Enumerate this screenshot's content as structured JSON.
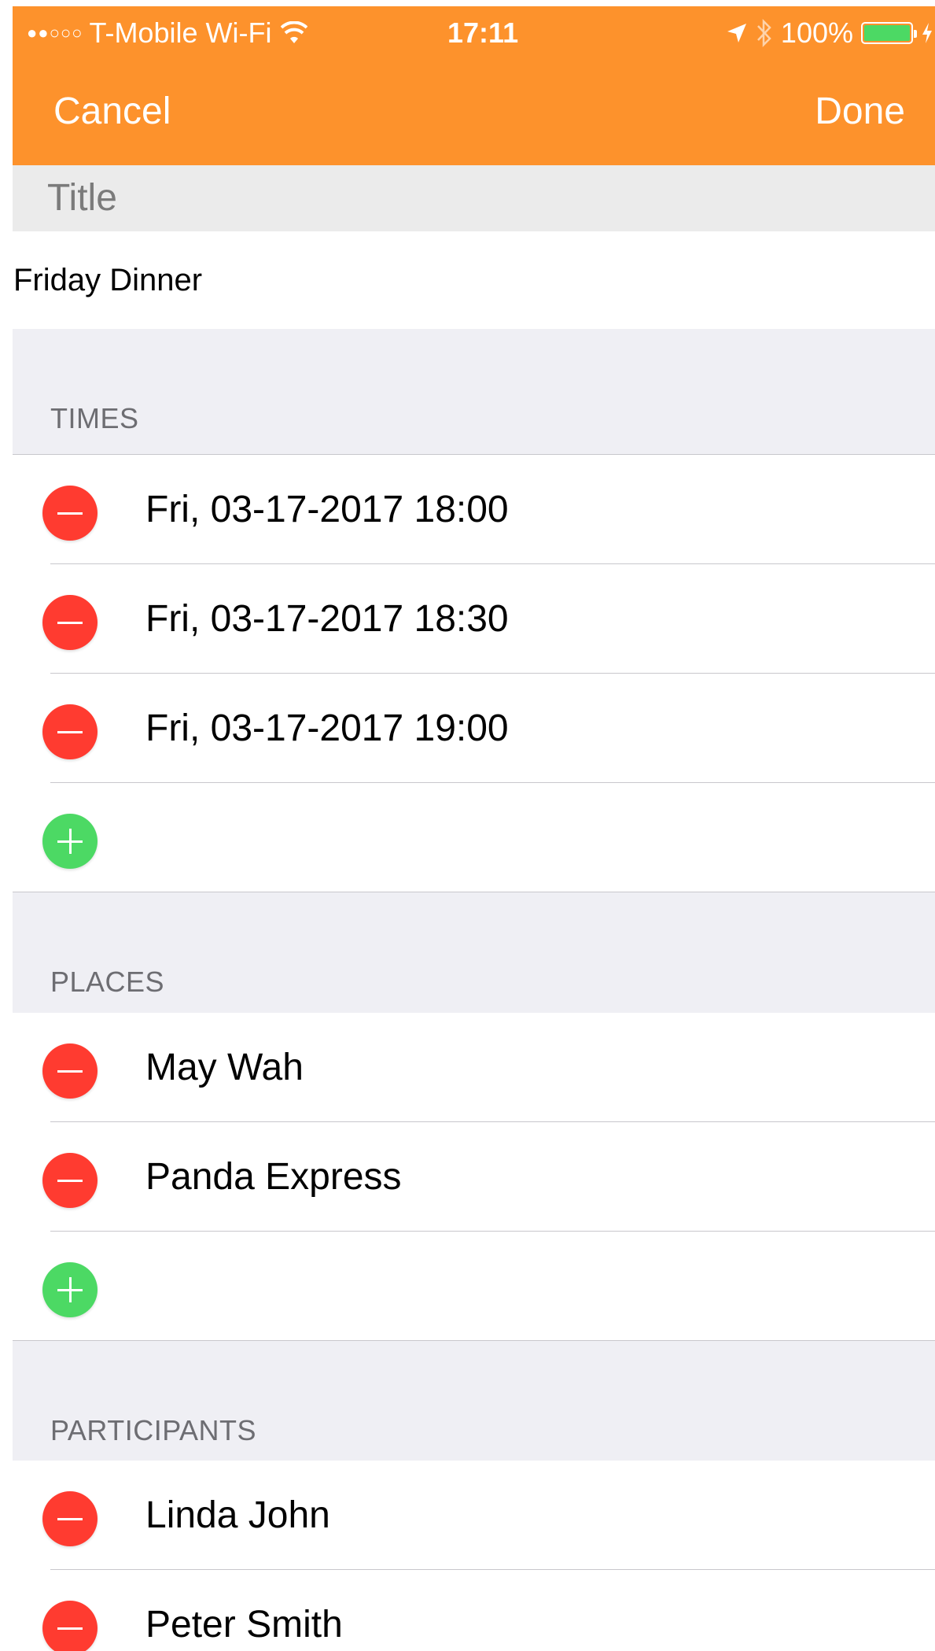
{
  "status_bar": {
    "signal": "●●○○○",
    "carrier": "T-Mobile Wi-Fi",
    "time": "17:11",
    "battery_percent": "100%",
    "battery_level": 1.0,
    "icons": [
      "wifi-icon",
      "location-arrow-icon",
      "bluetooth-icon",
      "battery-icon",
      "charging-bolt-icon"
    ]
  },
  "nav": {
    "cancel": "Cancel",
    "done": "Done"
  },
  "title": {
    "label": "Title",
    "value": "Friday Dinner"
  },
  "sections": {
    "times": {
      "header": "TIMES",
      "items": [
        "Fri, 03-17-2017 18:00",
        "Fri, 03-17-2017 18:30",
        "Fri, 03-17-2017 19:00"
      ]
    },
    "places": {
      "header": "PLACES",
      "items": [
        "May Wah",
        "Panda Express"
      ]
    },
    "participants": {
      "header": "PARTICIPANTS",
      "items": [
        "Linda John",
        "Peter Smith"
      ]
    }
  },
  "colors": {
    "nav_background": "#fd922c",
    "remove": "#ff3b30",
    "add": "#4cd964",
    "section_background": "#efeff4",
    "title_background": "#ebebeb"
  }
}
